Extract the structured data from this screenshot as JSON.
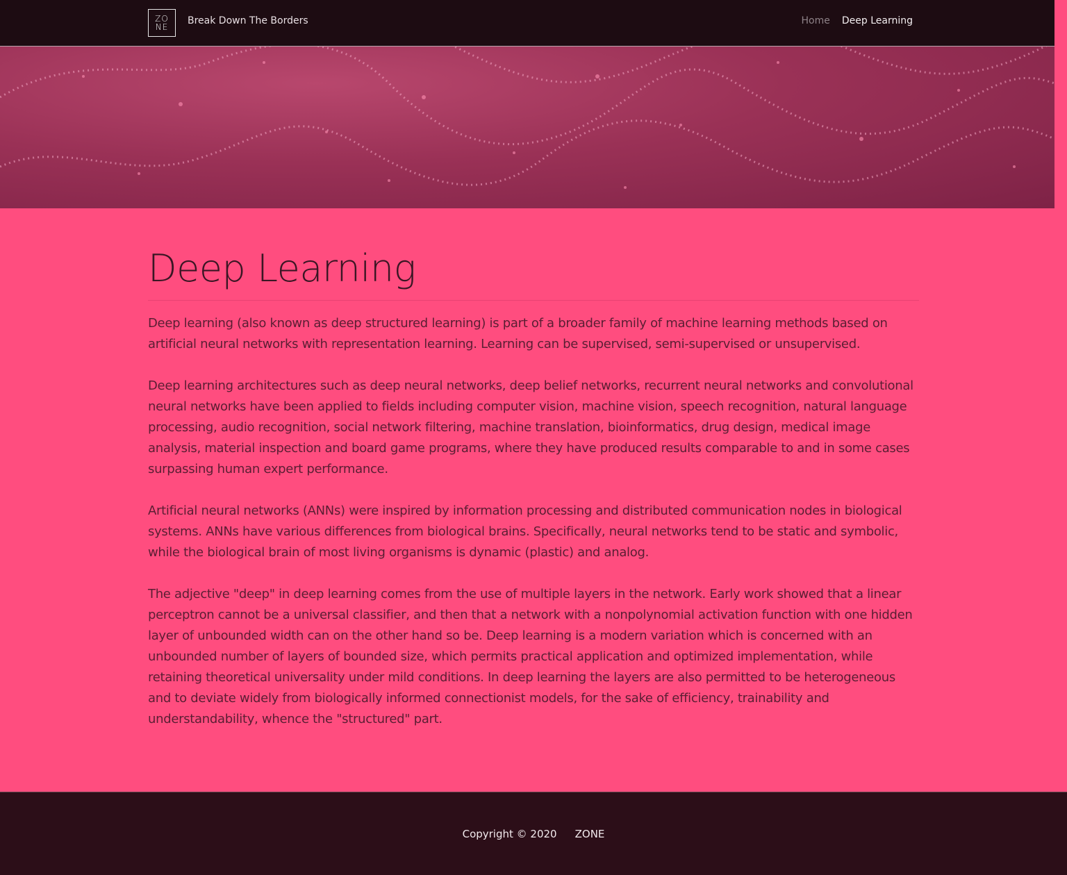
{
  "navbar": {
    "logo_top": "ZO",
    "logo_bottom": "NE",
    "brand": "Break Down The Borders",
    "links": [
      {
        "label": "Home"
      },
      {
        "label": "Deep Learning"
      }
    ]
  },
  "main": {
    "title": "Deep Learning",
    "paragraphs": [
      "Deep learning (also known as deep structured learning) is part of a broader family of machine learning methods based on artificial neural networks with representation learning. Learning can be supervised, semi-supervised or unsupervised.",
      "Deep learning architectures such as deep neural networks, deep belief networks, recurrent neural networks and convolutional neural networks have been applied to fields including computer vision, machine vision, speech recognition, natural language processing, audio recognition, social network filtering, machine translation, bioinformatics, drug design, medical image analysis, material inspection and board game programs, where they have produced results comparable to and in some cases surpassing human expert performance.",
      "Artificial neural networks (ANNs) were inspired by information processing and distributed communication nodes in biological systems. ANNs have various differences from biological brains. Specifically, neural networks tend to be static and symbolic, while the biological brain of most living organisms is dynamic (plastic) and analog.",
      "The adjective \"deep\" in deep learning comes from the use of multiple layers in the network. Early work showed that a linear perceptron cannot be a universal classifier, and then that a network with a nonpolynomial activation function with one hidden layer of unbounded width can on the other hand so be. Deep learning is a modern variation which is concerned with an unbounded number of layers of bounded size, which permits practical application and optimized implementation, while retaining theoretical universality under mild conditions. In deep learning the layers are also permitted to be heterogeneous and to deviate widely from biologically informed connectionist models, for the sake of efficiency, trainability and understandability, whence the \"structured\" part."
    ]
  },
  "footer": {
    "copyright": "Copyright © 2020",
    "brand": "ZONE"
  },
  "colors": {
    "page_background": "#ff4d7f",
    "navbar_background": "#1d0c12",
    "footer_background": "#2c0e18",
    "hero_tint": "#9a3156"
  }
}
